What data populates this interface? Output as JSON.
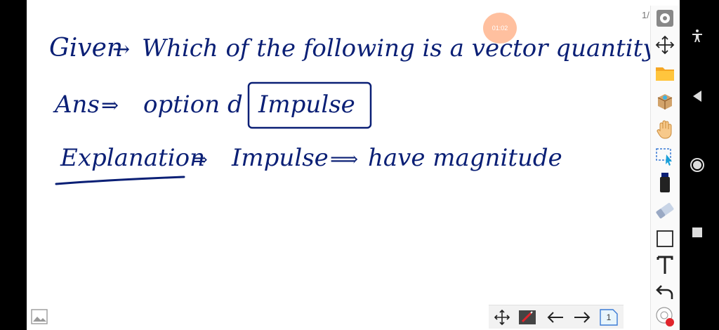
{
  "whiteboard": {
    "line1_given": "Given",
    "line1_question": "Which of the following is a vector quantity",
    "line2_label": "Ans",
    "line2_text": "option d",
    "line2_answer": "Impulse",
    "line3_label": "Explanation",
    "line3_text": "Impulse",
    "line3_tail": "have magnitude"
  },
  "timer": "01:02",
  "page_indicator": "1/",
  "bottom_bar": {
    "page_number": "1"
  },
  "colors": {
    "ink": "#0a1f75",
    "accent": "#ff8c50"
  },
  "icons": {
    "toolbar": [
      "settings-icon",
      "move-icon",
      "folder-icon",
      "box-icon",
      "hand-icon",
      "select-icon",
      "marker-icon",
      "eraser-icon",
      "rectangle-icon",
      "text-icon",
      "undo-icon",
      "logo-icon"
    ],
    "nav": [
      "accessibility-icon",
      "back-icon",
      "home-icon",
      "recents-icon"
    ]
  }
}
